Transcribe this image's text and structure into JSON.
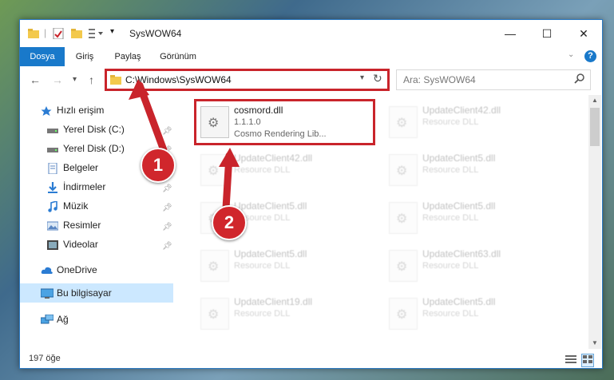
{
  "window": {
    "title": "SysWOW64",
    "controls": {
      "minimize": "—",
      "maximize": "☐",
      "close": "✕"
    }
  },
  "ribbon": {
    "tabs": [
      "Dosya",
      "Giriş",
      "Paylaş",
      "Görünüm"
    ],
    "active_tab": "Dosya",
    "help": "?"
  },
  "address": {
    "path": "C:\\Windows\\SysWOW64",
    "refresh_icon": "refresh-icon",
    "search_placeholder": "Ara: SysWOW64"
  },
  "sidebar": {
    "items": [
      {
        "label": "Hızlı erişim",
        "icon": "star-icon",
        "pinned": false
      },
      {
        "label": "Yerel Disk (C:)",
        "icon": "drive-icon",
        "pinned": true
      },
      {
        "label": "Yerel Disk (D:)",
        "icon": "drive-icon",
        "pinned": true
      },
      {
        "label": "Belgeler",
        "icon": "documents-icon",
        "pinned": true
      },
      {
        "label": "İndirmeler",
        "icon": "download-icon",
        "pinned": true
      },
      {
        "label": "Müzik",
        "icon": "music-icon",
        "pinned": true
      },
      {
        "label": "Resimler",
        "icon": "pictures-icon",
        "pinned": true
      },
      {
        "label": "Videolar",
        "icon": "videos-icon",
        "pinned": true
      },
      {
        "label": "OneDrive",
        "icon": "cloud-icon",
        "pinned": false
      },
      {
        "label": "Bu bilgisayar",
        "icon": "computer-icon",
        "pinned": false,
        "selected": true
      },
      {
        "label": "Ağ",
        "icon": "network-icon",
        "pinned": false
      }
    ]
  },
  "files": [
    {
      "name": "cosmord.dll",
      "version": "1.1.1.0",
      "desc": "Cosmo Rendering Lib..."
    },
    {
      "name": "UpdateClient42.dll",
      "desc": "Resource DLL"
    },
    {
      "name": "UpdateClient42.dll",
      "desc": "Resource DLL"
    },
    {
      "name": "UpdateClient5.dll",
      "desc": "Resource DLL"
    },
    {
      "name": "UpdateClient5.dll",
      "desc": "Resource DLL"
    },
    {
      "name": "UpdateClient5.dll",
      "desc": "Resource DLL"
    },
    {
      "name": "UpdateClient5.dll",
      "desc": "Resource DLL"
    },
    {
      "name": "UpdateClient63.dll",
      "desc": "Resource DLL"
    },
    {
      "name": "UpdateClient19.dll",
      "desc": "Resource DLL"
    },
    {
      "name": "UpdateClient5.dll",
      "desc": "Resource DLL"
    }
  ],
  "status": {
    "count": "197 öğe"
  },
  "callouts": [
    "1",
    "2"
  ],
  "colors": {
    "accent": "#1979ca",
    "highlight": "#c9242b",
    "selected": "#cce8ff"
  }
}
